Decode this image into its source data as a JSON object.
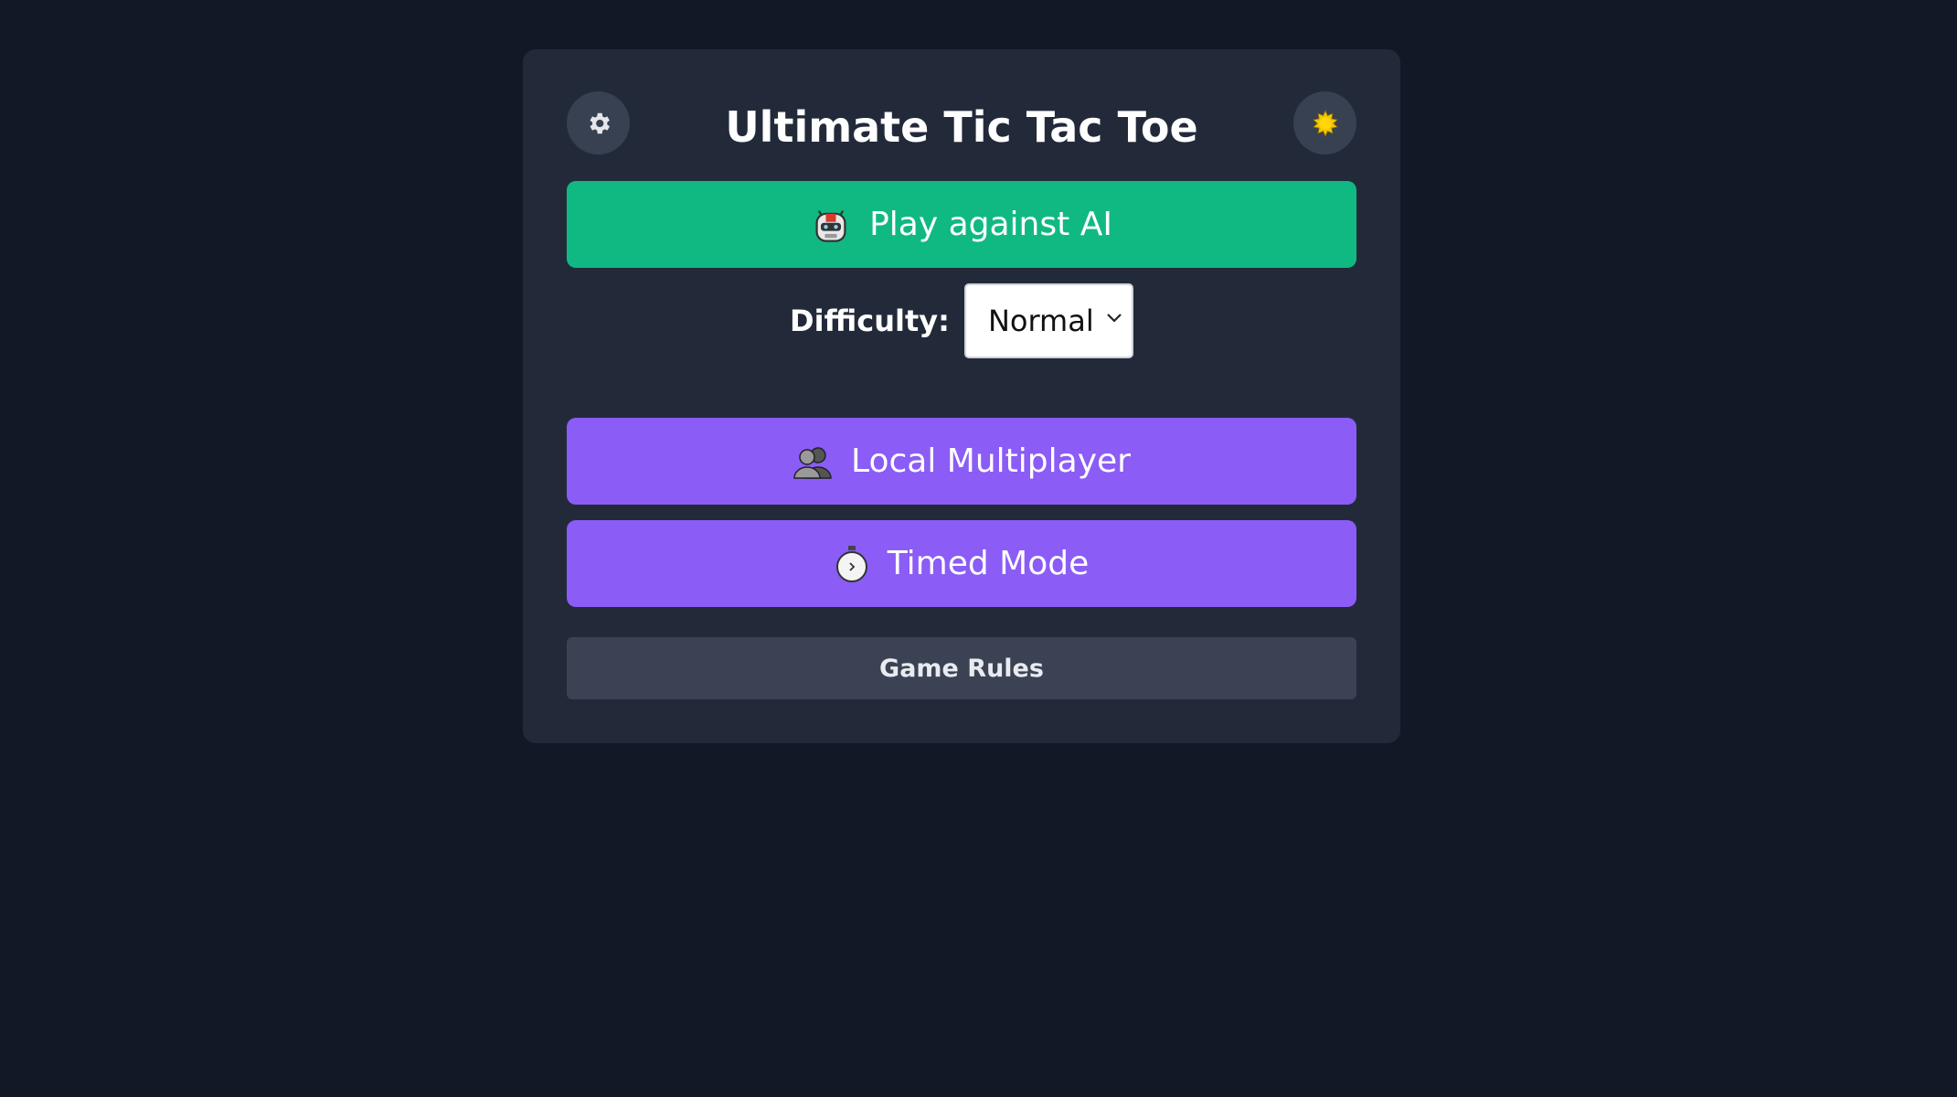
{
  "menu": {
    "title": "Ultimate Tic Tac Toe",
    "settings_icon": "gear-icon",
    "theme_icon": "sun-icon",
    "ai_button": {
      "label": "Play against AI",
      "icon": "robot-icon"
    },
    "difficulty": {
      "label": "Difficulty:",
      "selected": "Normal"
    },
    "multiplayer_button": {
      "label": "Local Multiplayer",
      "icon": "people-icon"
    },
    "timed_button": {
      "label": "Timed Mode",
      "icon": "stopwatch-icon"
    },
    "rules_button": {
      "label": "Game Rules"
    }
  },
  "colors": {
    "background": "#121826",
    "card": "#222a3a",
    "ai_green": "#10b981",
    "purple": "#8b5cf6",
    "rules_gray": "#3a4253"
  }
}
